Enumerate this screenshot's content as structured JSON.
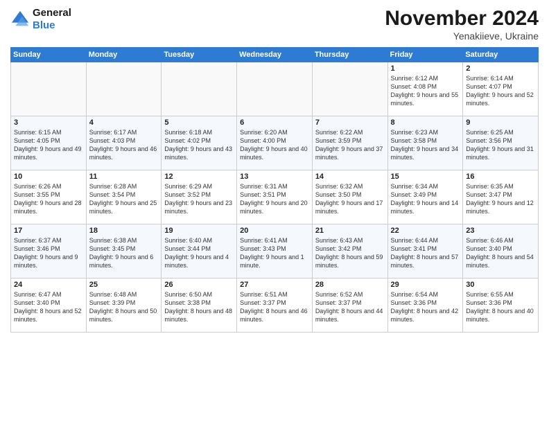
{
  "header": {
    "logo_line1": "General",
    "logo_line2": "Blue",
    "month": "November 2024",
    "location": "Yenakiieve, Ukraine"
  },
  "weekdays": [
    "Sunday",
    "Monday",
    "Tuesday",
    "Wednesday",
    "Thursday",
    "Friday",
    "Saturday"
  ],
  "weeks": [
    [
      {
        "day": "",
        "info": ""
      },
      {
        "day": "",
        "info": ""
      },
      {
        "day": "",
        "info": ""
      },
      {
        "day": "",
        "info": ""
      },
      {
        "day": "",
        "info": ""
      },
      {
        "day": "1",
        "info": "Sunrise: 6:12 AM\nSunset: 4:08 PM\nDaylight: 9 hours and 55 minutes."
      },
      {
        "day": "2",
        "info": "Sunrise: 6:14 AM\nSunset: 4:07 PM\nDaylight: 9 hours and 52 minutes."
      }
    ],
    [
      {
        "day": "3",
        "info": "Sunrise: 6:15 AM\nSunset: 4:05 PM\nDaylight: 9 hours and 49 minutes."
      },
      {
        "day": "4",
        "info": "Sunrise: 6:17 AM\nSunset: 4:03 PM\nDaylight: 9 hours and 46 minutes."
      },
      {
        "day": "5",
        "info": "Sunrise: 6:18 AM\nSunset: 4:02 PM\nDaylight: 9 hours and 43 minutes."
      },
      {
        "day": "6",
        "info": "Sunrise: 6:20 AM\nSunset: 4:00 PM\nDaylight: 9 hours and 40 minutes."
      },
      {
        "day": "7",
        "info": "Sunrise: 6:22 AM\nSunset: 3:59 PM\nDaylight: 9 hours and 37 minutes."
      },
      {
        "day": "8",
        "info": "Sunrise: 6:23 AM\nSunset: 3:58 PM\nDaylight: 9 hours and 34 minutes."
      },
      {
        "day": "9",
        "info": "Sunrise: 6:25 AM\nSunset: 3:56 PM\nDaylight: 9 hours and 31 minutes."
      }
    ],
    [
      {
        "day": "10",
        "info": "Sunrise: 6:26 AM\nSunset: 3:55 PM\nDaylight: 9 hours and 28 minutes."
      },
      {
        "day": "11",
        "info": "Sunrise: 6:28 AM\nSunset: 3:54 PM\nDaylight: 9 hours and 25 minutes."
      },
      {
        "day": "12",
        "info": "Sunrise: 6:29 AM\nSunset: 3:52 PM\nDaylight: 9 hours and 23 minutes."
      },
      {
        "day": "13",
        "info": "Sunrise: 6:31 AM\nSunset: 3:51 PM\nDaylight: 9 hours and 20 minutes."
      },
      {
        "day": "14",
        "info": "Sunrise: 6:32 AM\nSunset: 3:50 PM\nDaylight: 9 hours and 17 minutes."
      },
      {
        "day": "15",
        "info": "Sunrise: 6:34 AM\nSunset: 3:49 PM\nDaylight: 9 hours and 14 minutes."
      },
      {
        "day": "16",
        "info": "Sunrise: 6:35 AM\nSunset: 3:47 PM\nDaylight: 9 hours and 12 minutes."
      }
    ],
    [
      {
        "day": "17",
        "info": "Sunrise: 6:37 AM\nSunset: 3:46 PM\nDaylight: 9 hours and 9 minutes."
      },
      {
        "day": "18",
        "info": "Sunrise: 6:38 AM\nSunset: 3:45 PM\nDaylight: 9 hours and 6 minutes."
      },
      {
        "day": "19",
        "info": "Sunrise: 6:40 AM\nSunset: 3:44 PM\nDaylight: 9 hours and 4 minutes."
      },
      {
        "day": "20",
        "info": "Sunrise: 6:41 AM\nSunset: 3:43 PM\nDaylight: 9 hours and 1 minute."
      },
      {
        "day": "21",
        "info": "Sunrise: 6:43 AM\nSunset: 3:42 PM\nDaylight: 8 hours and 59 minutes."
      },
      {
        "day": "22",
        "info": "Sunrise: 6:44 AM\nSunset: 3:41 PM\nDaylight: 8 hours and 57 minutes."
      },
      {
        "day": "23",
        "info": "Sunrise: 6:46 AM\nSunset: 3:40 PM\nDaylight: 8 hours and 54 minutes."
      }
    ],
    [
      {
        "day": "24",
        "info": "Sunrise: 6:47 AM\nSunset: 3:40 PM\nDaylight: 8 hours and 52 minutes."
      },
      {
        "day": "25",
        "info": "Sunrise: 6:48 AM\nSunset: 3:39 PM\nDaylight: 8 hours and 50 minutes."
      },
      {
        "day": "26",
        "info": "Sunrise: 6:50 AM\nSunset: 3:38 PM\nDaylight: 8 hours and 48 minutes."
      },
      {
        "day": "27",
        "info": "Sunrise: 6:51 AM\nSunset: 3:37 PM\nDaylight: 8 hours and 46 minutes."
      },
      {
        "day": "28",
        "info": "Sunrise: 6:52 AM\nSunset: 3:37 PM\nDaylight: 8 hours and 44 minutes."
      },
      {
        "day": "29",
        "info": "Sunrise: 6:54 AM\nSunset: 3:36 PM\nDaylight: 8 hours and 42 minutes."
      },
      {
        "day": "30",
        "info": "Sunrise: 6:55 AM\nSunset: 3:36 PM\nDaylight: 8 hours and 40 minutes."
      }
    ]
  ]
}
